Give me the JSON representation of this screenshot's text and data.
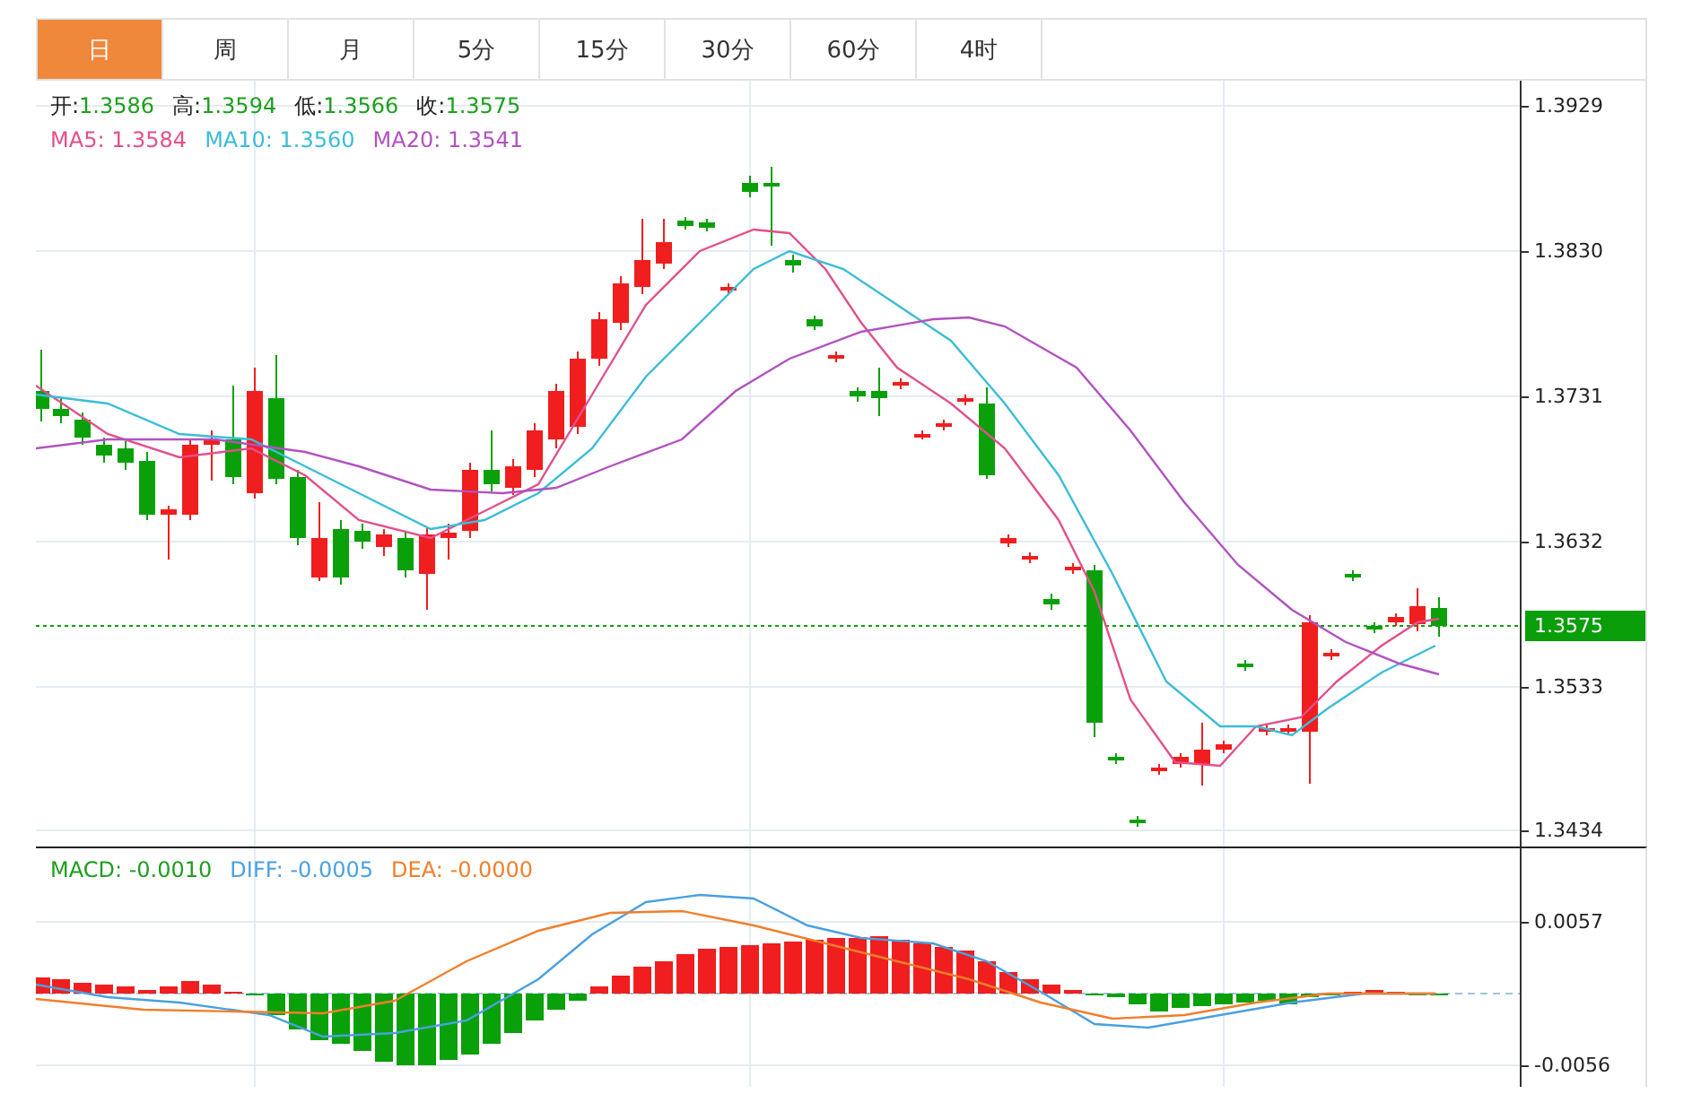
{
  "tabs": [
    {
      "label": "日",
      "selected": true
    },
    {
      "label": "周",
      "selected": false
    },
    {
      "label": "月",
      "selected": false
    },
    {
      "label": "5分",
      "selected": false
    },
    {
      "label": "15分",
      "selected": false
    },
    {
      "label": "30分",
      "selected": false
    },
    {
      "label": "60分",
      "selected": false
    },
    {
      "label": "4时",
      "selected": false
    }
  ],
  "price_legend": [
    {
      "label": "开:",
      "value": "1.3586"
    },
    {
      "label": "高:",
      "value": "1.3594"
    },
    {
      "label": "低:",
      "value": "1.3566"
    },
    {
      "label": "收:",
      "value": "1.3575"
    }
  ],
  "ma_legend": [
    {
      "label": "MA5:",
      "value": "1.3584",
      "color": "#e2508c"
    },
    {
      "label": "MA10:",
      "value": "1.3560",
      "color": "#3bbdd6"
    },
    {
      "label": "MA20:",
      "value": "1.3541",
      "color": "#b152c0"
    }
  ],
  "price_axis": [
    "1.3929",
    "1.3830",
    "1.3731",
    "1.3632",
    "1.3533",
    "1.3434"
  ],
  "current_price": "1.3575",
  "macd_legend": [
    {
      "label": "MACD:",
      "value": "-0.0010",
      "color": "#1e9e1e"
    },
    {
      "label": "DIFF:",
      "value": "-0.0005",
      "color": "#4aa0e0"
    },
    {
      "label": "DEA:",
      "value": "-0.0000",
      "color": "#f07f2c"
    }
  ],
  "macd_axis": [
    "0.0057",
    "-0.0056"
  ]
}
